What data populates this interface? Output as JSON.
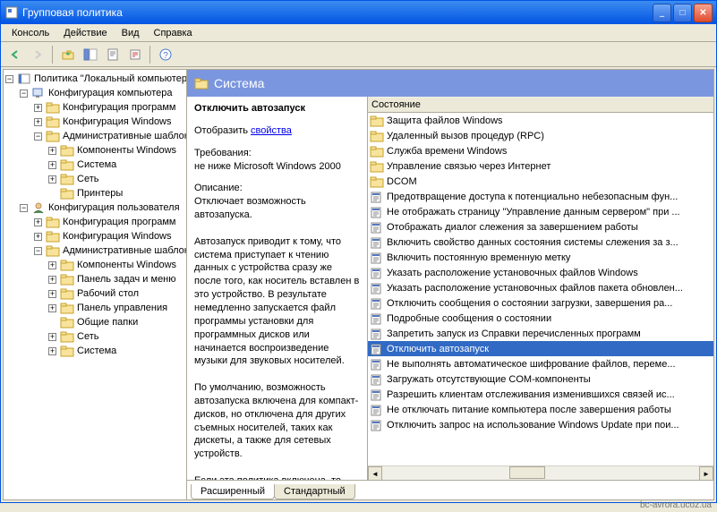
{
  "window": {
    "title": "Групповая политика"
  },
  "menu": [
    "Консоль",
    "Действие",
    "Вид",
    "Справка"
  ],
  "tree": [
    {
      "ind": 0,
      "exp": "-",
      "icon": "book",
      "label": "Политика \"Локальный компьютер\""
    },
    {
      "ind": 1,
      "exp": "-",
      "icon": "comp",
      "label": "Конфигурация компьютера"
    },
    {
      "ind": 2,
      "exp": "+",
      "icon": "folder",
      "label": "Конфигурация программ"
    },
    {
      "ind": 2,
      "exp": "+",
      "icon": "folder",
      "label": "Конфигурация Windows"
    },
    {
      "ind": 2,
      "exp": "-",
      "icon": "folder",
      "label": "Административные шаблоны"
    },
    {
      "ind": 3,
      "exp": "+",
      "icon": "folder",
      "label": "Компоненты Windows"
    },
    {
      "ind": 3,
      "exp": "+",
      "icon": "folder",
      "label": "Система"
    },
    {
      "ind": 3,
      "exp": "+",
      "icon": "folder",
      "label": "Сеть"
    },
    {
      "ind": 3,
      "exp": "",
      "icon": "folder",
      "label": "Принтеры"
    },
    {
      "ind": 1,
      "exp": "-",
      "icon": "user",
      "label": "Конфигурация пользователя"
    },
    {
      "ind": 2,
      "exp": "+",
      "icon": "folder",
      "label": "Конфигурация программ"
    },
    {
      "ind": 2,
      "exp": "+",
      "icon": "folder",
      "label": "Конфигурация Windows"
    },
    {
      "ind": 2,
      "exp": "-",
      "icon": "folder",
      "label": "Административные шаблоны"
    },
    {
      "ind": 3,
      "exp": "+",
      "icon": "folder",
      "label": "Компоненты Windows"
    },
    {
      "ind": 3,
      "exp": "+",
      "icon": "folder",
      "label": "Панель задач и меню"
    },
    {
      "ind": 3,
      "exp": "+",
      "icon": "folder",
      "label": "Рабочий стол"
    },
    {
      "ind": 3,
      "exp": "+",
      "icon": "folder",
      "label": "Панель управления"
    },
    {
      "ind": 3,
      "exp": "",
      "icon": "folder",
      "label": "Общие папки"
    },
    {
      "ind": 3,
      "exp": "+",
      "icon": "folder",
      "label": "Сеть"
    },
    {
      "ind": 3,
      "exp": "+",
      "icon": "folder",
      "label": "Система"
    }
  ],
  "header": {
    "title": "Система"
  },
  "desc": {
    "title": "Отключить автозапуск",
    "show_label": "Отобразить",
    "props_link": "свойства",
    "req_label": "Требования:",
    "req_text": "не ниже Microsoft Windows 2000",
    "desc_label": "Описание:",
    "body": "Отключает возможность автозапуска.\n\nАвтозапуск приводит к тому, что система приступает к чтению данных с устройства сразу же после того, как носитель вставлен в это устройство. В результате немедленно запускается файл программы установки для программных дисков или начинается воспроизведение музыки для звуковых носителей.\n\nПо умолчанию, возможность автозапуска включена для компакт-дисков, но отключена для других съемных носителей, таких как дискеты, а также для сетевых устройств.\n\nЕсли эта политика включена, то можно отключить автозапуск для"
  },
  "list_header": "Состояние",
  "items": [
    {
      "icon": "folder",
      "label": "Защита файлов Windows"
    },
    {
      "icon": "folder",
      "label": "Удаленный вызов процедур (RPC)"
    },
    {
      "icon": "folder",
      "label": "Служба времени Windows"
    },
    {
      "icon": "folder",
      "label": "Управление связью через Интернет"
    },
    {
      "icon": "folder",
      "label": "DCOM"
    },
    {
      "icon": "setting",
      "label": "Предотвращение доступа к потенциально небезопасным фун..."
    },
    {
      "icon": "setting",
      "label": "Не отображать страницу \"Управление данным сервером\" при ..."
    },
    {
      "icon": "setting",
      "label": "Отображать диалог слежения за завершением работы"
    },
    {
      "icon": "setting",
      "label": "Включить свойство данных состояния системы слежения за з..."
    },
    {
      "icon": "setting",
      "label": "Включить постоянную временную метку"
    },
    {
      "icon": "setting",
      "label": "Указать расположение установочных файлов Windows"
    },
    {
      "icon": "setting",
      "label": "Указать расположение установочных файлов пакета обновлен..."
    },
    {
      "icon": "setting",
      "label": "Отключить сообщения о состоянии загрузки, завершения ра..."
    },
    {
      "icon": "setting",
      "label": "Подробные сообщения о состоянии"
    },
    {
      "icon": "setting",
      "label": "Запретить запуск из Справки перечисленных программ"
    },
    {
      "icon": "setting",
      "label": "Отключить автозапуск",
      "sel": true
    },
    {
      "icon": "setting",
      "label": "Не выполнять автоматическое шифрование файлов, переме..."
    },
    {
      "icon": "setting",
      "label": "Загружать отсутствующие COM-компоненты"
    },
    {
      "icon": "setting",
      "label": "Разрешить клиентам отслеживания изменившихся связей ис..."
    },
    {
      "icon": "setting",
      "label": "Не отключать питание компьютера после завершения работы"
    },
    {
      "icon": "setting",
      "label": "Отключить запрос на использование Windows Update при пои..."
    }
  ],
  "tabs": {
    "extended": "Расширенный",
    "standard": "Стандартный"
  },
  "watermark": "bc-avrora.ucoz.ua"
}
